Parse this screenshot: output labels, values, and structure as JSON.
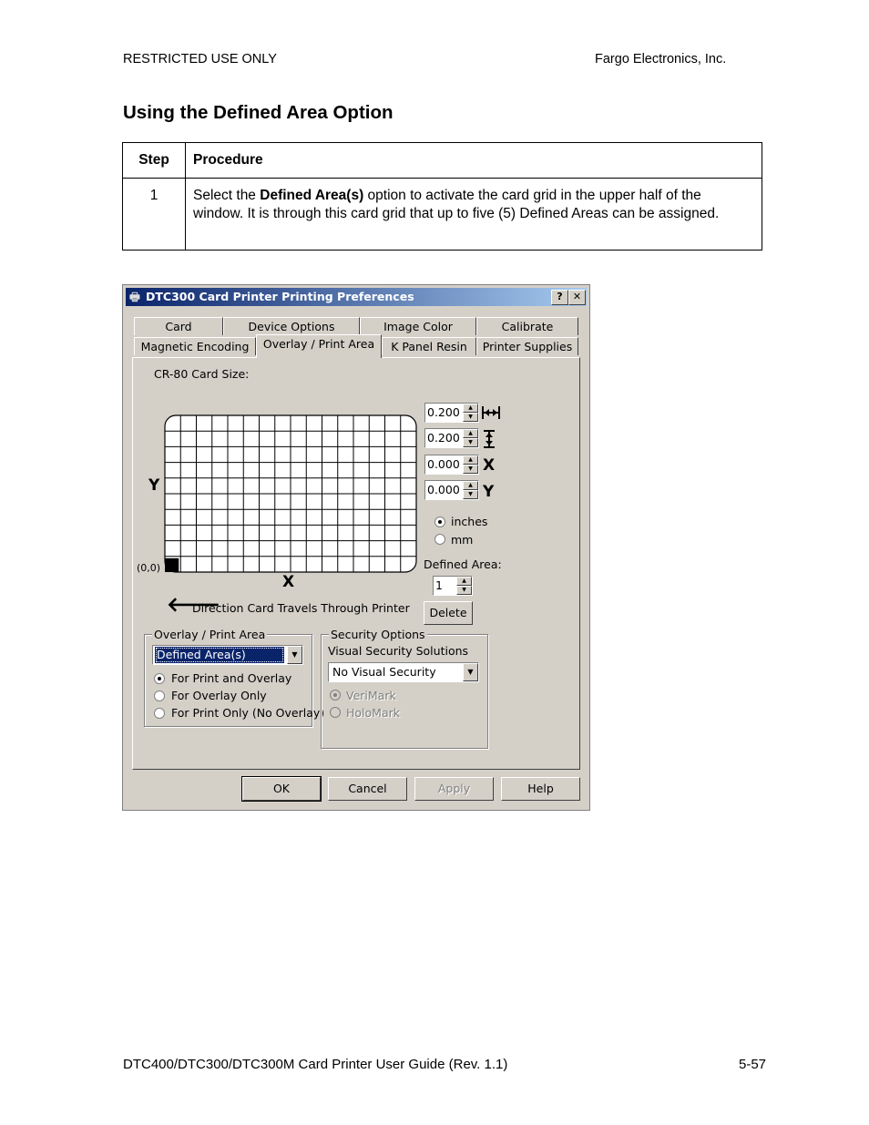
{
  "header": {
    "left": "RESTRICTED USE ONLY",
    "right": "Fargo Electronics, Inc."
  },
  "section_title": "Using the Defined Area Option",
  "table": {
    "col_step": "Step",
    "col_procedure": "Procedure",
    "rows": [
      {
        "step": "1",
        "pre": "Select the ",
        "bold": "Defined Area(s)",
        "post": " option to activate the card grid in the upper half of the window. It is through this card grid that up to five (5) Defined Areas can be assigned."
      }
    ]
  },
  "dialog": {
    "title": "DTC300 Card Printer Printing Preferences",
    "help_btn": "?",
    "close_btn": "✕",
    "tabs_row1": [
      "Card",
      "Device Options",
      "Image Color",
      "Calibrate"
    ],
    "tabs_row2": [
      "Magnetic Encoding",
      "Overlay / Print Area",
      "K Panel Resin",
      "Printer Supplies"
    ],
    "active_tab": "Overlay / Print Area",
    "card_size_label": "CR-80 Card Size:",
    "spin_values": [
      "0.200",
      "0.200",
      "0.000",
      "0.000"
    ],
    "spin_icons": [
      "width-icon",
      "height-icon",
      "x-icon",
      "y-icon"
    ],
    "icon_x": "X",
    "icon_y": "Y",
    "axis_y": "Y",
    "axis_x": "X",
    "origin_label": "(0,0)",
    "units": {
      "inches": "inches",
      "mm": "mm",
      "selected": "inches"
    },
    "defined_area_label": "Defined Area:",
    "defined_area_value": "1",
    "delete_btn": "Delete",
    "direction_text": "Direction Card Travels Through Printer",
    "overlay_group": {
      "legend": "Overlay / Print Area",
      "combo_value": "Defined Area(s)",
      "options": [
        "For Print and Overlay",
        "For Overlay Only",
        "For Print Only (No Overlay)"
      ],
      "selected": 0
    },
    "security_group": {
      "legend": "Security Options",
      "sub_label": "Visual Security Solutions",
      "combo_value": "No Visual Security",
      "options": [
        "VeriMark",
        "HoloMark"
      ],
      "selected": 0
    },
    "buttons": {
      "ok": "OK",
      "cancel": "Cancel",
      "apply": "Apply",
      "help": "Help"
    },
    "grid": {
      "columns": 16,
      "rows": 10
    }
  },
  "footer": {
    "left": "DTC400/DTC300/DTC300M Card Printer User Guide (Rev. 1.1)",
    "right": "5-57"
  }
}
